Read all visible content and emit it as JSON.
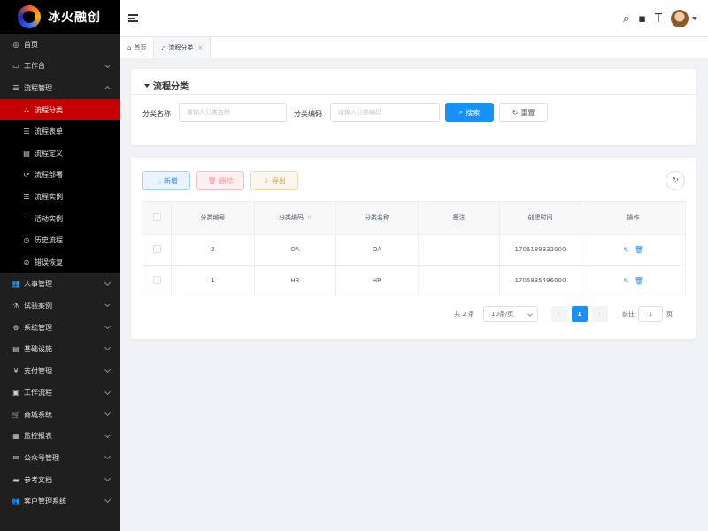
{
  "app": {
    "title": "冰火融创"
  },
  "sidebar": {
    "items": [
      {
        "label": "首页",
        "icon": "dashboard-icon",
        "glyph": "◎",
        "chevron": false
      },
      {
        "label": "工作台",
        "icon": "monitor-icon",
        "glyph": "▭",
        "chevron": true
      },
      {
        "label": "流程管理",
        "icon": "list-icon",
        "glyph": "☰",
        "chevron": true,
        "expanded": true
      },
      {
        "label": "人事管理",
        "icon": "users-icon",
        "glyph": "👥",
        "chevron": true
      },
      {
        "label": "试验案例",
        "icon": "flask-icon",
        "glyph": "⚗",
        "chevron": true
      },
      {
        "label": "系统管理",
        "icon": "gear-icon",
        "glyph": "⚙",
        "chevron": true
      },
      {
        "label": "基础设施",
        "icon": "server-icon",
        "glyph": "▤",
        "chevron": true
      },
      {
        "label": "支付管理",
        "icon": "yen-icon",
        "glyph": "¥",
        "chevron": true
      },
      {
        "label": "工作流程",
        "icon": "workflow-icon",
        "glyph": "▣",
        "chevron": true
      },
      {
        "label": "商城系统",
        "icon": "cart-icon",
        "glyph": "🛒",
        "chevron": true
      },
      {
        "label": "监控报表",
        "icon": "chart-icon",
        "glyph": "▦",
        "chevron": true
      },
      {
        "label": "公众号管理",
        "icon": "wechat-icon",
        "glyph": "✉",
        "chevron": true
      },
      {
        "label": "参考文档",
        "icon": "document-icon",
        "glyph": "▬",
        "chevron": true
      },
      {
        "label": "客户管理系统",
        "icon": "customer-icon",
        "glyph": "👥",
        "chevron": true
      }
    ],
    "submenu": [
      {
        "label": "流程分类",
        "icon": "sitemap-icon",
        "glyph": "⛬",
        "active": true
      },
      {
        "label": "流程表单",
        "icon": "form-icon",
        "glyph": "☰"
      },
      {
        "label": "流程定义",
        "icon": "file-icon",
        "glyph": "▤"
      },
      {
        "label": "流程部署",
        "icon": "deploy-icon",
        "glyph": "⟳"
      },
      {
        "label": "流程实例",
        "icon": "instance-icon",
        "glyph": "☰"
      },
      {
        "label": "活动实例",
        "icon": "activity-icon",
        "glyph": "⋯"
      },
      {
        "label": "历史流程",
        "icon": "history-icon",
        "glyph": "◷"
      },
      {
        "label": "错误恢复",
        "icon": "recover-icon",
        "glyph": "⊘"
      }
    ]
  },
  "tabs": [
    {
      "label": "首页",
      "icon": "home-icon",
      "glyph": "⌂",
      "active": false
    },
    {
      "label": "流程分类",
      "icon": "sitemap-icon",
      "glyph": "⛬",
      "active": true,
      "close": "×"
    }
  ],
  "search": {
    "title": "流程分类",
    "name_label": "分类名称",
    "name_placeholder": "请输入分类名称",
    "code_label": "分类编码",
    "code_placeholder": "请输入分类编码",
    "search_button": "搜索",
    "reset_button": "重置"
  },
  "toolbar": {
    "add": "新增",
    "delete": "删除",
    "export": "导出"
  },
  "table": {
    "headers": [
      "分类编号",
      "分类编码",
      "分类名称",
      "备注",
      "创建时间",
      "操作"
    ],
    "rows": [
      {
        "id": "2",
        "code": "OA",
        "name": "OA",
        "remark": "",
        "created": "1706189332000"
      },
      {
        "id": "1",
        "code": "HR",
        "name": "HR",
        "remark": "",
        "created": "1705835496000"
      }
    ]
  },
  "pagination": {
    "total": "共 2 条",
    "page_size": "10条/页",
    "current_page": "1",
    "goto_label": "前往",
    "goto_value": "1",
    "page_suffix": "页"
  },
  "colors": {
    "primary": "#1890ff",
    "active_menu": "#c40000",
    "sidebar_bg": "#1f1f1f"
  }
}
